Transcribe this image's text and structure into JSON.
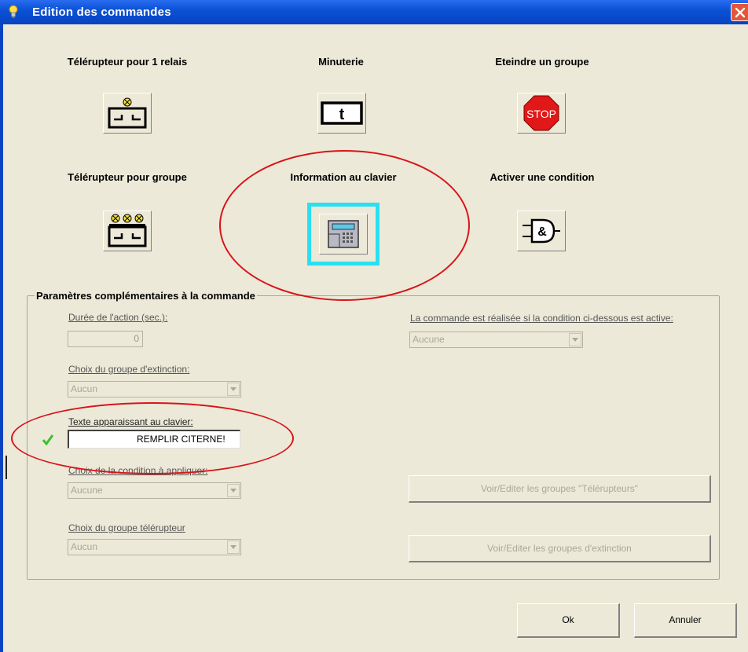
{
  "window": {
    "title": "Edition des commandes",
    "icon": "lightbulb-icon",
    "accent_color": "#0a52d6"
  },
  "commands": [
    {
      "label": "Télérupteur pour 1 relais",
      "icon": "relay-icon"
    },
    {
      "label": "Minuterie",
      "icon": "timer-icon",
      "glyph": "t"
    },
    {
      "label": "Eteindre un groupe",
      "icon": "stop-icon",
      "glyph": "STOP"
    },
    {
      "label": "Télérupteur pour groupe",
      "icon": "relay-group-icon"
    },
    {
      "label": "Information au clavier",
      "icon": "keypad-icon",
      "selected": true
    },
    {
      "label": "Activer une condition",
      "icon": "and-gate-icon",
      "glyph": "&"
    }
  ],
  "params": {
    "group_title": "Paramètres complémentaires à la commande",
    "duration": {
      "label": "Durée de l'action (sec.):",
      "value": "0"
    },
    "extinction_group": {
      "label": "Choix du groupe d'extinction:",
      "value": "Aucun"
    },
    "keyboard_text": {
      "label": "Texte apparaissant au clavier:",
      "value": "REMPLIR CITERNE!"
    },
    "condition_apply": {
      "label": "Choix de la condition à appliquer:",
      "value": "Aucune"
    },
    "relay_group": {
      "label": "Choix du groupe télérupteur",
      "value": "Aucun"
    },
    "condition_active": {
      "label": "La commande est réalisée si la condition ci-dessous est active:",
      "value": "Aucune"
    },
    "edit_relay_groups_label": "Voir/Editer les groupes \"Télérupteurs\"",
    "edit_extinction_groups_label": "Voir/Editer les groupes d'extinction"
  },
  "buttons": {
    "ok": "Ok",
    "cancel": "Annuler"
  },
  "annotation_color": "#d8141a",
  "selection_color": "#28e0f0"
}
